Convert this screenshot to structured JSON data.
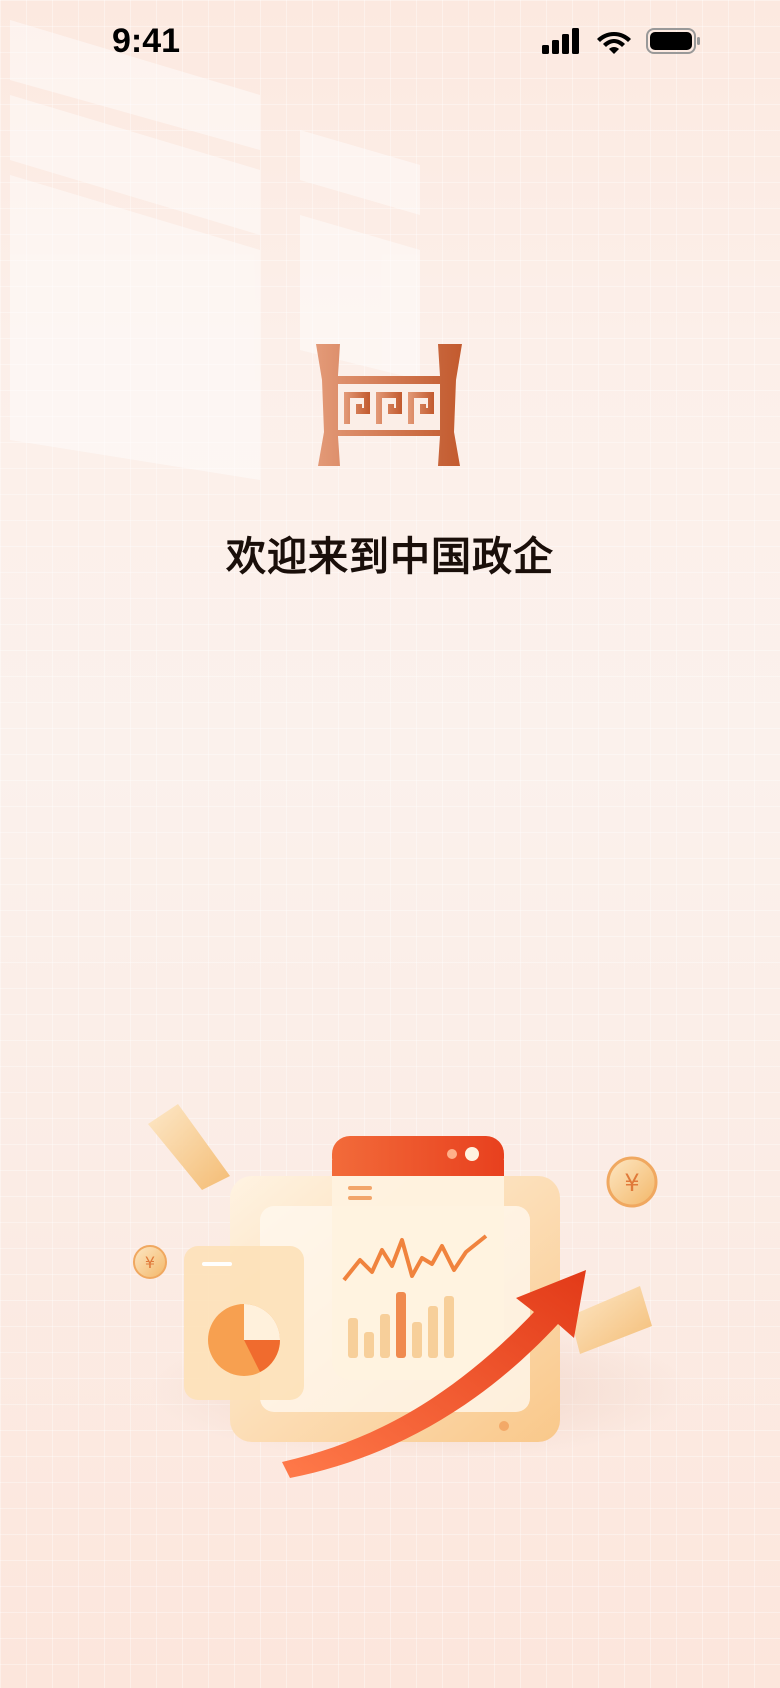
{
  "status_bar": {
    "time": "9:41",
    "icons": [
      "cellular-signal-icon",
      "wifi-icon",
      "battery-icon"
    ]
  },
  "brand": {
    "logo": "brand-logo-icon",
    "welcome_text": "欢迎来到中国政企"
  },
  "colors": {
    "brand_primary": "#c9643c",
    "brand_light": "#e39a78",
    "text_primary": "#1a0f0a",
    "accent_red": "#f04a2a",
    "accent_gold": "#f7c46a"
  },
  "illustration": {
    "name": "finance-dashboard-illustration",
    "elements": [
      "ticket-icon",
      "coin-yuan-icon",
      "pie-chart-card",
      "line-chart-card",
      "bar-chart",
      "growth-arrow-icon"
    ]
  }
}
